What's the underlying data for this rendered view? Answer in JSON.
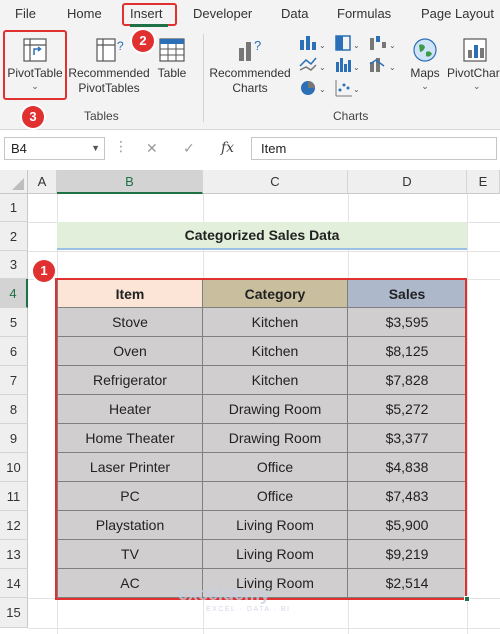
{
  "ribbon": {
    "tabs": [
      "File",
      "Home",
      "Insert",
      "Developer",
      "Data",
      "Formulas",
      "Page Layout"
    ],
    "active_tab": "Insert",
    "buttons": {
      "pivot_table": "PivotTable",
      "recommended_pivot_line1": "Recommended",
      "recommended_pivot_line2": "PivotTables",
      "table": "Table",
      "recommended_charts_line1": "Recommended",
      "recommended_charts_line2": "Charts",
      "maps": "Maps",
      "pivot_chart": "PivotChart"
    },
    "groups": {
      "tables": "Tables",
      "charts": "Charts"
    },
    "chevron": "⌄"
  },
  "formula_bar": {
    "name_box": "B4",
    "cancel_icon": "✕",
    "enter_icon": "✓",
    "fx": "fx",
    "value": "Item"
  },
  "grid": {
    "columns": [
      "A",
      "B",
      "C",
      "D",
      "E"
    ],
    "selected_column": "B",
    "rows": [
      "1",
      "2",
      "3",
      "4",
      "5",
      "6",
      "7",
      "8",
      "9",
      "10",
      "11",
      "12",
      "13",
      "14",
      "15"
    ],
    "selected_row": "4"
  },
  "sheet": {
    "title": "Categorized Sales Data",
    "headers": {
      "item": "Item",
      "category": "Category",
      "sales": "Sales"
    },
    "rows": [
      {
        "item": "Stove",
        "category": "Kitchen",
        "sales": "$3,595"
      },
      {
        "item": "Oven",
        "category": "Kitchen",
        "sales": "$8,125"
      },
      {
        "item": "Refrigerator",
        "category": "Kitchen",
        "sales": "$7,828"
      },
      {
        "item": "Heater",
        "category": "Drawing Room",
        "sales": "$5,272"
      },
      {
        "item": "Home Theater",
        "category": "Drawing Room",
        "sales": "$3,377"
      },
      {
        "item": "Laser Printer",
        "category": "Office",
        "sales": "$4,838"
      },
      {
        "item": "PC",
        "category": "Office",
        "sales": "$7,483"
      },
      {
        "item": "Playstation",
        "category": "Living Room",
        "sales": "$5,900"
      },
      {
        "item": "TV",
        "category": "Living Room",
        "sales": "$9,219"
      },
      {
        "item": "AC",
        "category": "Living Room",
        "sales": "$2,514"
      }
    ]
  },
  "annotations": {
    "step1": "1",
    "step2": "2",
    "step3": "3"
  },
  "watermark": {
    "name": "exceldemy",
    "tagline": "EXCEL · DATA · BI"
  },
  "colors": {
    "accent_green": "#1e7145",
    "annotation_red": "#e03030",
    "item_header_fill": "#fce4d6",
    "category_header_fill": "#c9bf9f",
    "sales_header_fill": "#adb9ca",
    "data_fill": "#d0cece",
    "title_fill": "#e2efda"
  }
}
